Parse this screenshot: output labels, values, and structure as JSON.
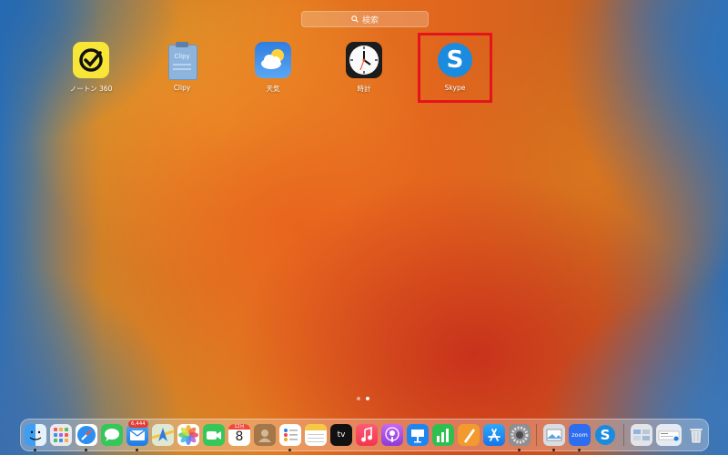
{
  "search": {
    "placeholder": "検索"
  },
  "apps": [
    {
      "label": "ノートン 360",
      "icon": "norton-icon"
    },
    {
      "label": "Clipy",
      "icon": "clipy-icon",
      "icon_text": "Clipy"
    },
    {
      "label": "天気",
      "icon": "weather-icon"
    },
    {
      "label": "時計",
      "icon": "clock-icon"
    },
    {
      "label": "Skype",
      "icon": "skype-icon",
      "icon_text": "S"
    }
  ],
  "highlight_color": "#e3141b",
  "page_indicator": {
    "count": 2,
    "active": 2
  },
  "dock": {
    "mail_badge": "6,444",
    "calendar": {
      "month": "12月",
      "day": "8"
    },
    "tv_label": "tv",
    "zoom_label": "zoom",
    "skype_letter": "S",
    "items": [
      "finder-icon",
      "launchpad-icon",
      "safari-icon",
      "messages-icon",
      "mail-icon",
      "maps-icon",
      "photos-icon",
      "facetime-icon",
      "calendar-icon",
      "contacts-icon",
      "reminders-icon",
      "notes-icon",
      "apple-tv-icon",
      "music-icon",
      "podcasts-icon",
      "keynote-icon",
      "numbers-icon",
      "pages-icon",
      "app-store-icon",
      "system-settings-icon",
      "preview-icon",
      "zoom-icon",
      "skype-icon",
      "downloads-stack-icon",
      "documents-stack-icon",
      "trash-icon"
    ]
  }
}
